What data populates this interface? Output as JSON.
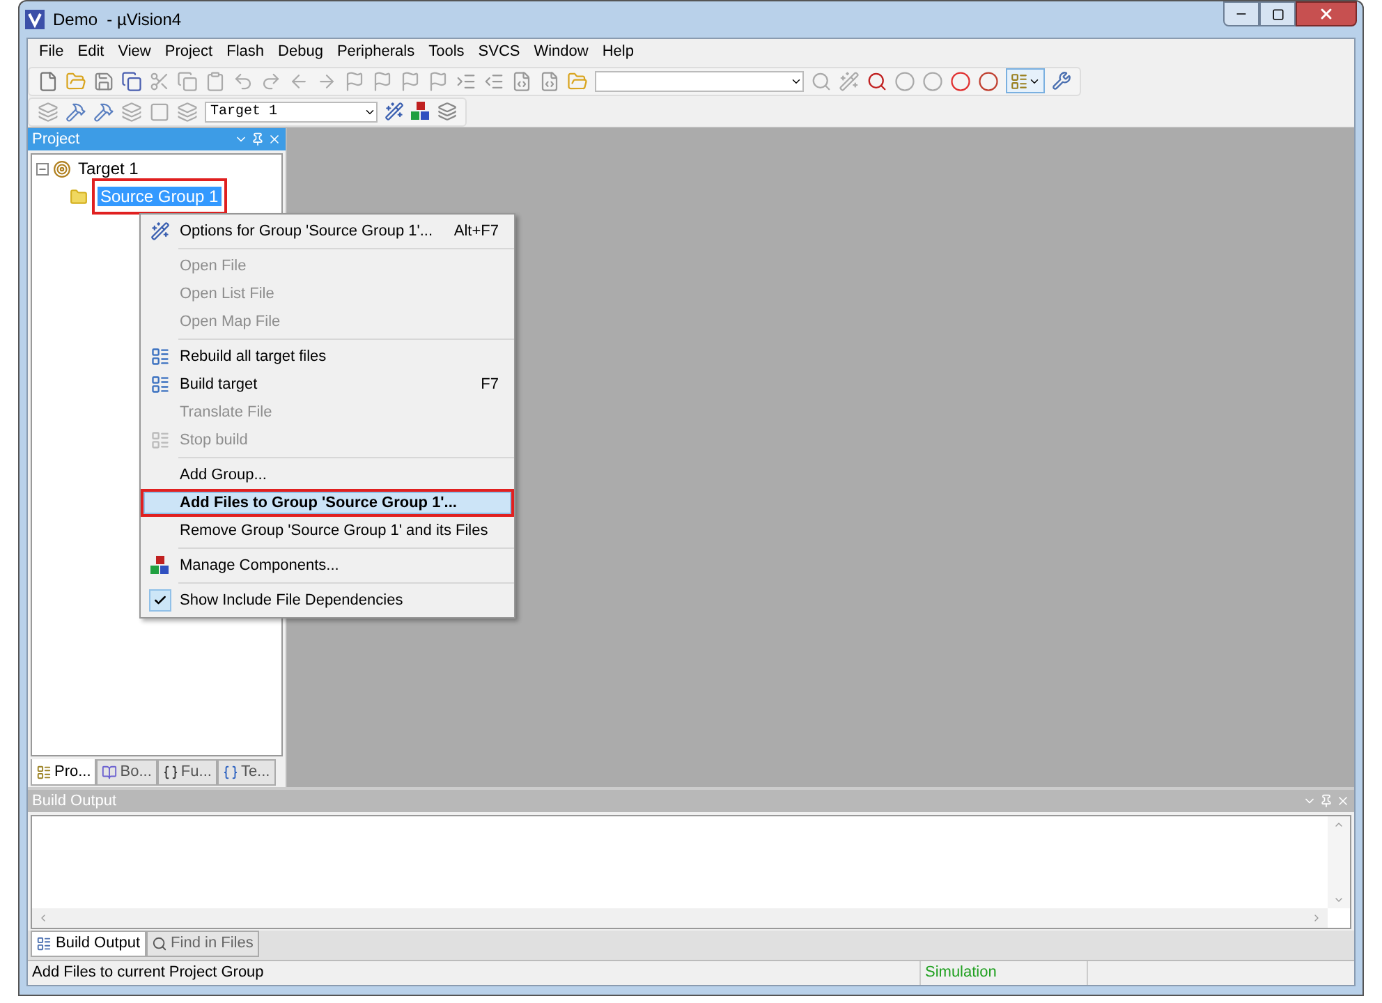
{
  "window": {
    "title": "Demo  - µVision4"
  },
  "menu_bar": [
    "File",
    "Edit",
    "View",
    "Project",
    "Flash",
    "Debug",
    "Peripherals",
    "Tools",
    "SVCS",
    "Window",
    "Help"
  ],
  "toolbar": {
    "target": "Target 1"
  },
  "project_panel": {
    "title": "Project",
    "tree": [
      {
        "label": "Target 1",
        "expanded": true,
        "selected": false,
        "children": [
          {
            "label": "Source Group 1",
            "selected": true,
            "annotated": true
          }
        ]
      }
    ],
    "tabs": [
      {
        "label": "Pro...",
        "selected": true
      },
      {
        "label": "Bo...",
        "selected": false
      },
      {
        "label": "Fu...",
        "selected": false
      },
      {
        "label": "Te...",
        "selected": false
      }
    ]
  },
  "context_menu": [
    {
      "kind": "item",
      "label": "Options for Group 'Source Group 1'...",
      "shortcut": "Alt+F7",
      "disabled": false,
      "selected": false,
      "annotated": false
    },
    {
      "kind": "separator"
    },
    {
      "kind": "item",
      "label": "Open File",
      "disabled": true,
      "selected": false,
      "annotated": false
    },
    {
      "kind": "item",
      "label": "Open List File",
      "disabled": true,
      "selected": false,
      "annotated": false
    },
    {
      "kind": "item",
      "label": "Open Map File",
      "disabled": true,
      "selected": false,
      "annotated": false
    },
    {
      "kind": "separator"
    },
    {
      "kind": "item",
      "label": "Rebuild all target files",
      "disabled": false,
      "selected": false,
      "annotated": false
    },
    {
      "kind": "item",
      "label": "Build target",
      "shortcut": "F7",
      "disabled": false,
      "selected": false,
      "annotated": false
    },
    {
      "kind": "item",
      "label": "Translate File",
      "disabled": true,
      "selected": false,
      "annotated": false
    },
    {
      "kind": "item",
      "label": "Stop build",
      "disabled": true,
      "selected": false,
      "annotated": false
    },
    {
      "kind": "separator"
    },
    {
      "kind": "item",
      "label": "Add Group...",
      "disabled": false,
      "selected": false,
      "annotated": false
    },
    {
      "kind": "item",
      "label": "Add Files to Group 'Source Group 1'...",
      "disabled": false,
      "selected": true,
      "annotated": true
    },
    {
      "kind": "item",
      "label": "Remove Group 'Source Group 1' and its Files",
      "disabled": false,
      "selected": false,
      "annotated": false
    },
    {
      "kind": "separator"
    },
    {
      "kind": "item",
      "label": "Manage Components...",
      "disabled": false,
      "selected": false,
      "annotated": false
    },
    {
      "kind": "separator"
    },
    {
      "kind": "check",
      "label": "Show Include File Dependencies",
      "checked": true,
      "disabled": false,
      "selected": false,
      "annotated": false
    }
  ],
  "build_output": {
    "title": "Build Output",
    "tabs": [
      {
        "label": "Build Output",
        "selected": true
      },
      {
        "label": "Find in Files",
        "selected": false
      }
    ]
  },
  "status_bar": {
    "message": "Add Files to current Project Group",
    "mode": "Simulation"
  }
}
